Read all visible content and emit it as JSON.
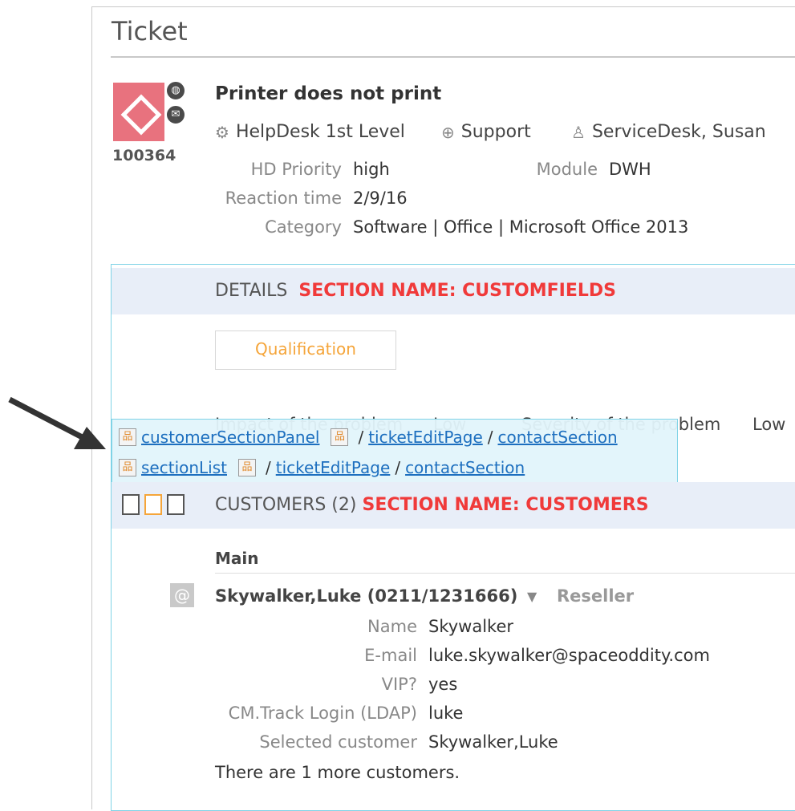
{
  "page": {
    "title": "Ticket"
  },
  "ticket": {
    "number": "100364",
    "title": "Printer does not print",
    "badges": [
      "globe-icon",
      "mail-icon"
    ],
    "team": "HelpDesk 1st Level",
    "service": "Support",
    "assignee": "ServiceDesk, Susan",
    "fields": {
      "hd_priority_label": "HD Priority",
      "hd_priority": "high",
      "module_label": "Module",
      "module": "DWH",
      "reaction_label": "Reaction time",
      "reaction": "2/9/16",
      "category_label": "Category",
      "category": "Software | Office | Microsoft Office 2013"
    }
  },
  "details": {
    "title": "DETAILS",
    "section_name": "SECTION NAME: CUSTOMFIELDS",
    "tab": "Qualification",
    "behind_left": "Impact of the problem",
    "behind_mid": "Low",
    "behind_right_label": "Severity of the problem",
    "behind_right_value": "Low"
  },
  "overlay": {
    "row1": [
      "customerSectionPanel",
      "ticketEditPage",
      "contactSection"
    ],
    "row2": [
      "sectionList",
      "ticketEditPage",
      "contactSection"
    ],
    "separator": "/"
  },
  "customers": {
    "title": "CUSTOMERS (2)",
    "section_name": "SECTION NAME: CUSTOMERS",
    "group": "Main",
    "name_line": "Skywalker,Luke (0211/1231666)",
    "role": "Reseller",
    "fields": [
      {
        "label": "Name",
        "value": "Skywalker"
      },
      {
        "label": "E-mail",
        "value": "luke.skywalker@spaceoddity.com"
      },
      {
        "label": "VIP?",
        "value": "yes"
      },
      {
        "label": "CM.Track Login (LDAP)",
        "value": "luke"
      },
      {
        "label": "Selected customer",
        "value": "Skywalker,Luke"
      }
    ],
    "more": "There are 1 more customers."
  },
  "colors": {
    "accent_red": "#f03a3a",
    "link_blue": "#1d6fbf",
    "orange": "#f5a53a",
    "logo_pink": "#e8727e"
  }
}
